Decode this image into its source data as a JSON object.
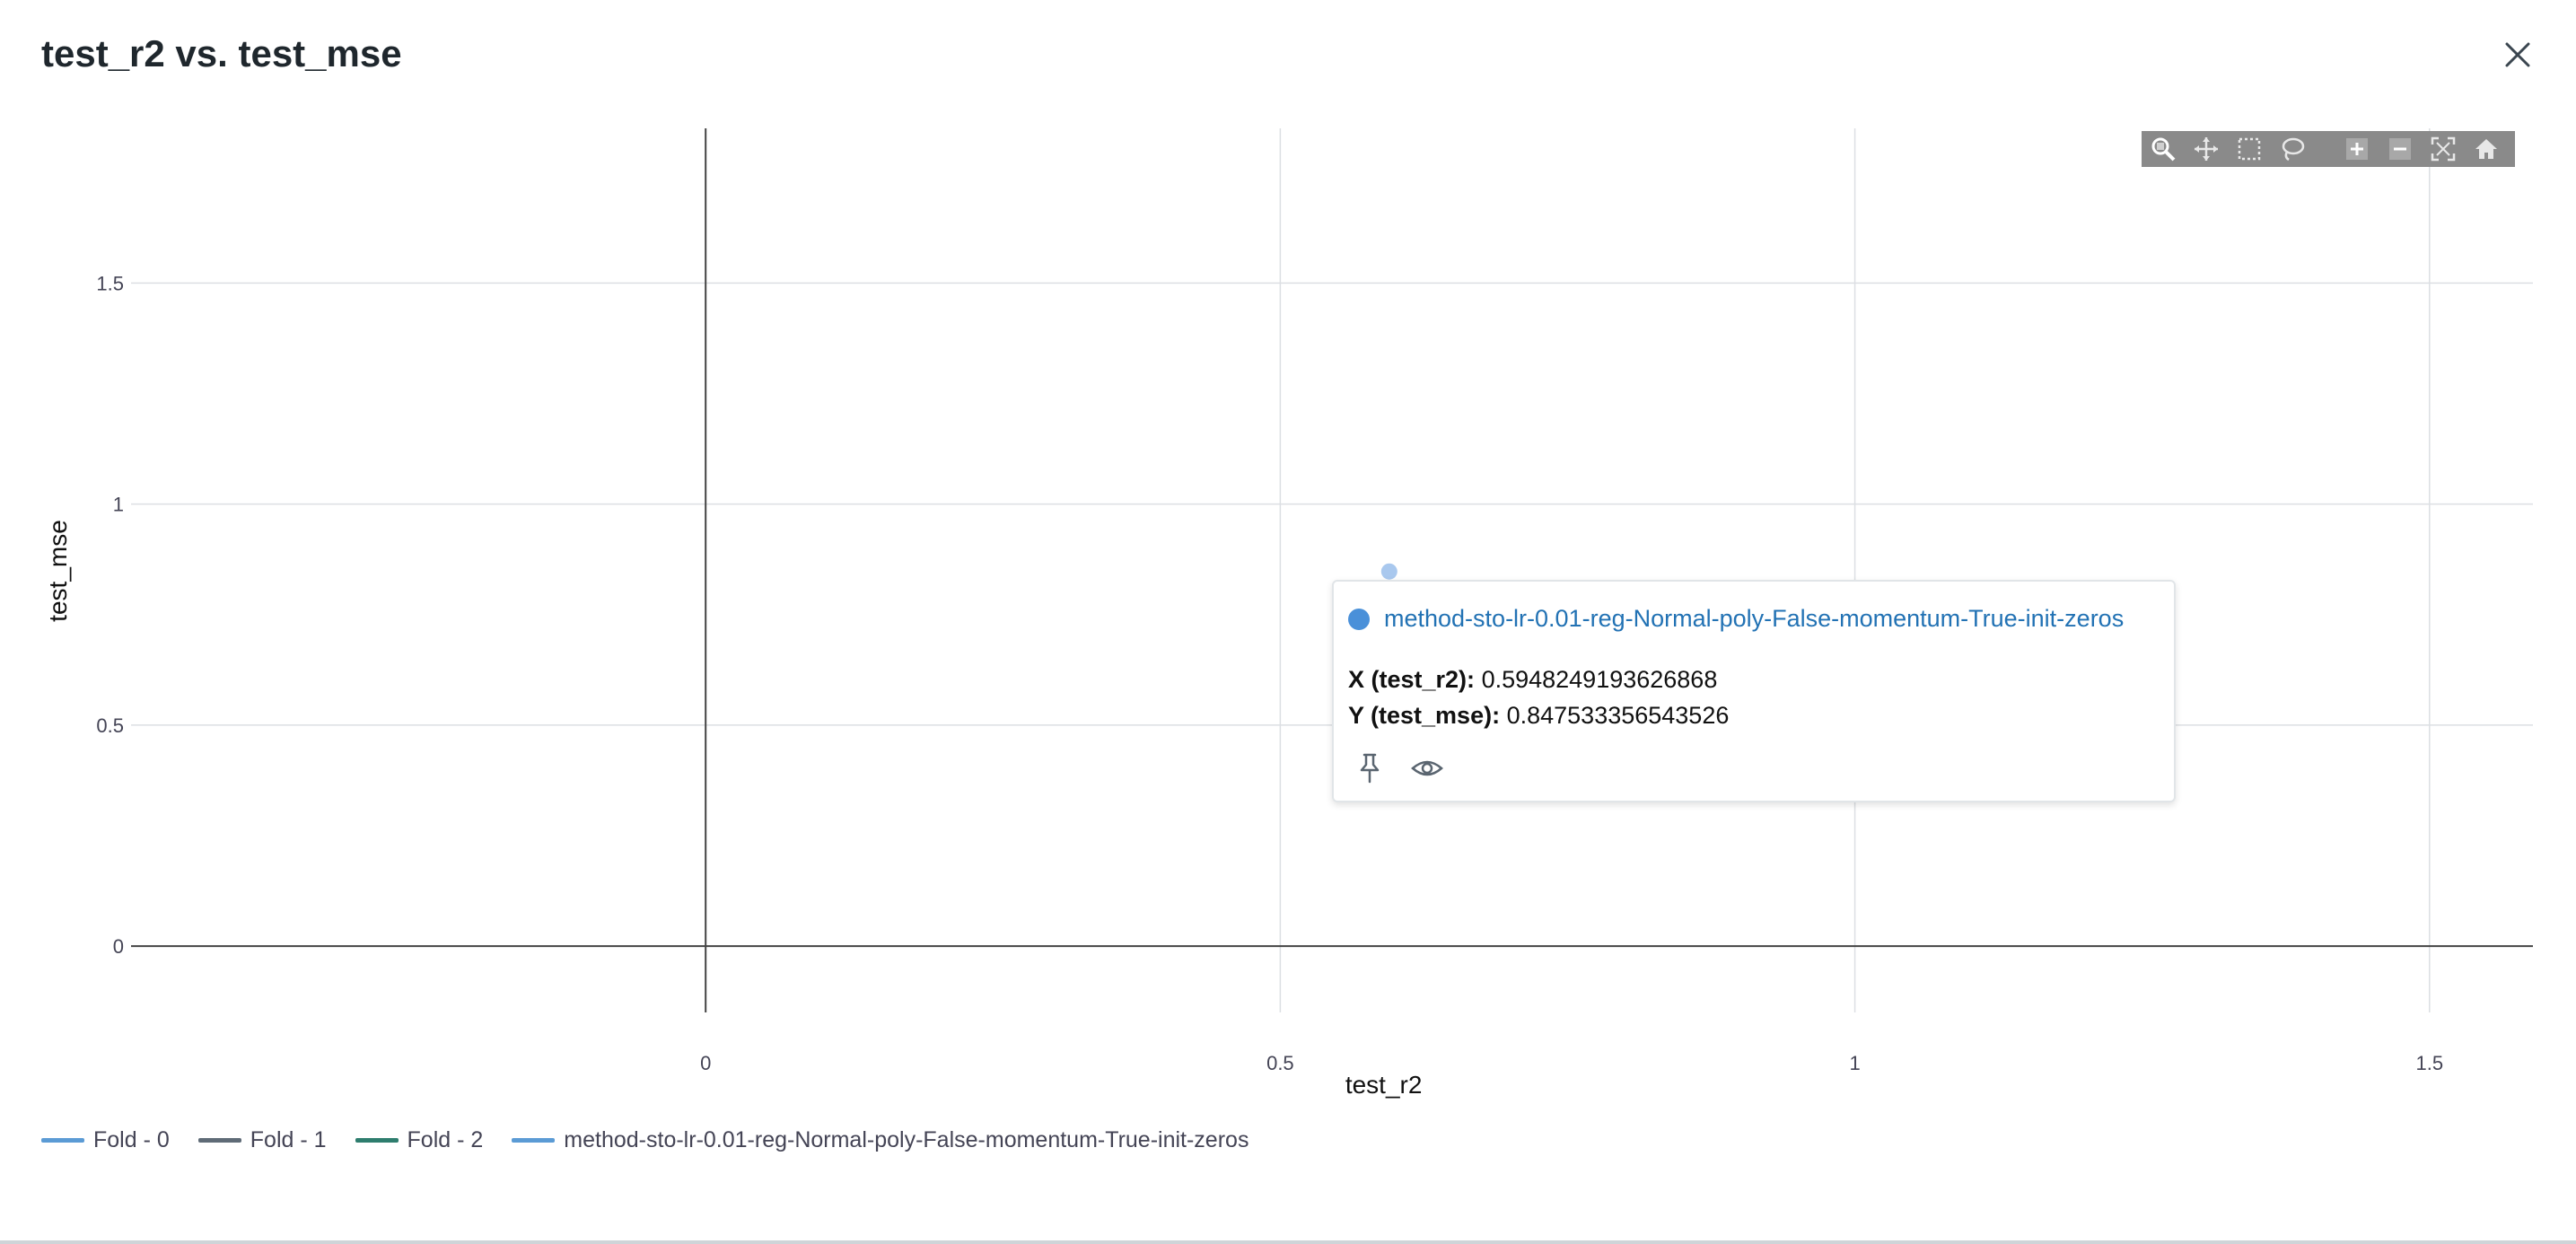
{
  "modal": {
    "title": "test_r2 vs. test_mse",
    "close_icon": "close-icon"
  },
  "modebar": {
    "icons": [
      "zoom-icon",
      "pan-icon",
      "box-select-icon",
      "lasso-select-icon",
      "zoom-in-icon",
      "zoom-out-icon",
      "autoscale-icon",
      "reset-axes-icon"
    ]
  },
  "tooltip": {
    "run_name": "method-sto-lr-0.01-reg-Normal-poly-False-momentum-True-init-zeros",
    "x_label": "X (test_r2):",
    "x_value": "0.5948249193626868",
    "y_label": "Y (test_mse):",
    "y_value": "0.847533356543526",
    "dot_color": "#4a90d9",
    "actions": [
      "pin-icon",
      "eye-icon"
    ]
  },
  "legend": [
    {
      "label": "Fold - 0",
      "color": "#5b9bd5"
    },
    {
      "label": "Fold - 1",
      "color": "#5f6b77"
    },
    {
      "label": "Fold - 2",
      "color": "#2e7d6e"
    },
    {
      "label": "method-sto-lr-0.01-reg-Normal-poly-False-momentum-True-init-zeros",
      "color": "#5b9bd5"
    }
  ],
  "chart_data": {
    "type": "scatter",
    "title": "test_r2 vs. test_mse",
    "xlabel": "test_r2",
    "ylabel": "test_mse",
    "xlim": [
      -0.5,
      1.59
    ],
    "ylim": [
      -0.15,
      1.85
    ],
    "x_ticks": [
      0,
      0.5,
      1,
      1.5
    ],
    "x_tick_labels": [
      "0",
      "0.5",
      "1",
      "1.5"
    ],
    "y_ticks": [
      0,
      0.5,
      1,
      1.5
    ],
    "y_tick_labels": [
      "0",
      "0.5",
      "1",
      "1.5"
    ],
    "grid": true,
    "legend_position": "bottom-left",
    "series": [
      {
        "name": "method-sto-lr-0.01-reg-Normal-poly-False-momentum-True-init-zeros",
        "color": "#a9c8ee",
        "points": [
          {
            "x": 0.5948249193626868,
            "y": 0.847533356543526
          }
        ]
      }
    ]
  }
}
